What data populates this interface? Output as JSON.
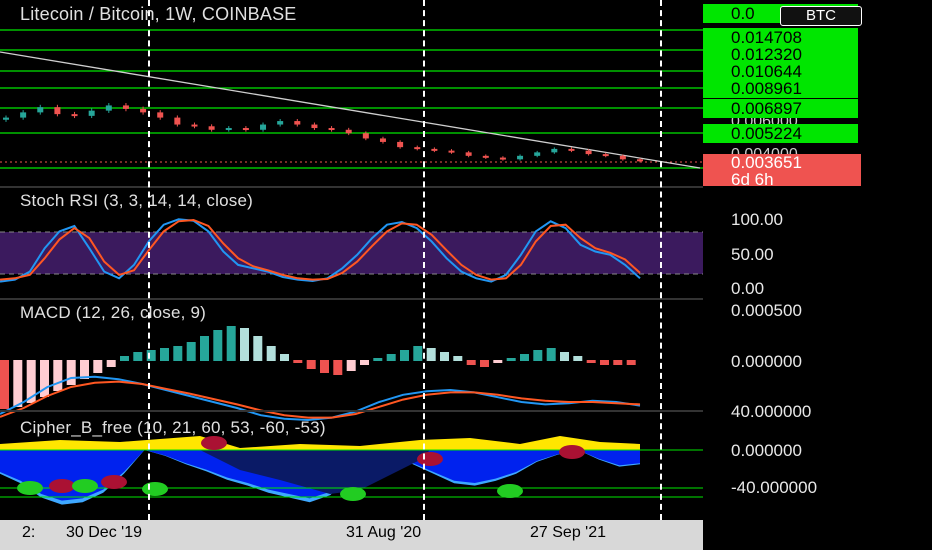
{
  "header": {
    "title": "Litecoin / Bitcoin, 1W, COINBASE",
    "currency_tag": "BTC"
  },
  "price_levels": [
    "0.014708",
    "0.012320",
    "0.010644",
    "0.008961",
    "0.006897",
    "0.005224"
  ],
  "partial_levels": [
    "0.0",
    "0.006000",
    "0.004000"
  ],
  "current_price": {
    "value": "0.003651",
    "countdown": "6d 6h",
    "color": "#ef5350"
  },
  "stoch_rsi": {
    "title": "Stoch RSI (3, 3, 14, 14, close)",
    "axis": [
      "100.00",
      "50.00",
      "0.00"
    ],
    "k_color": "#2196f3",
    "d_color": "#ff5722",
    "band_color": "#3b1a5e"
  },
  "macd": {
    "title": "MACD (12, 26, close, 9)",
    "axis": [
      "0.000500",
      "0.000000",
      "40.000000"
    ]
  },
  "cipher": {
    "title": "Cipher_B_free (10, 21, 60, 53, -60, -53)",
    "axis": [
      "0.000000",
      "-40.000000"
    ]
  },
  "time_axis": [
    "2:",
    "30 Dec '19",
    "31 Aug '20",
    "27 Sep '21"
  ],
  "colors": {
    "level_line": "#00e600",
    "bull": "#26a69a",
    "bear": "#ef5350"
  },
  "chart_data": {
    "type": "line",
    "series": [
      {
        "values": [
          0.0062,
          0.0065,
          0.0068,
          0.0064,
          0.0063,
          0.0066,
          0.0069,
          0.0067,
          0.0065,
          0.0062,
          0.0058,
          0.0057,
          0.0055,
          0.0056,
          0.0055,
          0.0058,
          0.006,
          0.0058,
          0.0056,
          0.0055,
          0.0053,
          0.005,
          0.0048,
          0.0045,
          0.0044,
          0.0043,
          0.0042,
          0.004,
          0.0039,
          0.0038,
          0.004,
          0.0042,
          0.0044,
          0.0043,
          0.0041,
          0.004,
          0.0038,
          0.0037
        ]
      }
    ]
  }
}
